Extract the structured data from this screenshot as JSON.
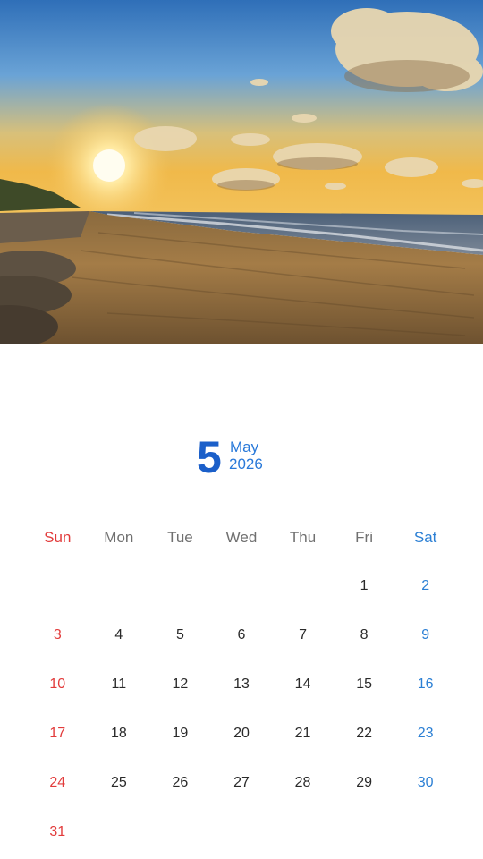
{
  "photo": {
    "subject": "beach-sunset-photo"
  },
  "month": {
    "number": "5",
    "name": "May",
    "year": "2026"
  },
  "weekdays": [
    "Sun",
    "Mon",
    "Tue",
    "Wed",
    "Thu",
    "Fri",
    "Sat"
  ],
  "weeks": [
    [
      "",
      "",
      "",
      "",
      "",
      "1",
      "2"
    ],
    [
      "3",
      "4",
      "5",
      "6",
      "7",
      "8",
      "9"
    ],
    [
      "10",
      "11",
      "12",
      "13",
      "14",
      "15",
      "16"
    ],
    [
      "17",
      "18",
      "19",
      "20",
      "21",
      "22",
      "23"
    ],
    [
      "24",
      "25",
      "26",
      "27",
      "28",
      "29",
      "30"
    ],
    [
      "31",
      "",
      "",
      "",
      "",
      "",
      ""
    ]
  ],
  "colors": {
    "sunday": "#e23b3b",
    "saturday": "#2b7fd4",
    "month_number": "#1b5fc9"
  }
}
